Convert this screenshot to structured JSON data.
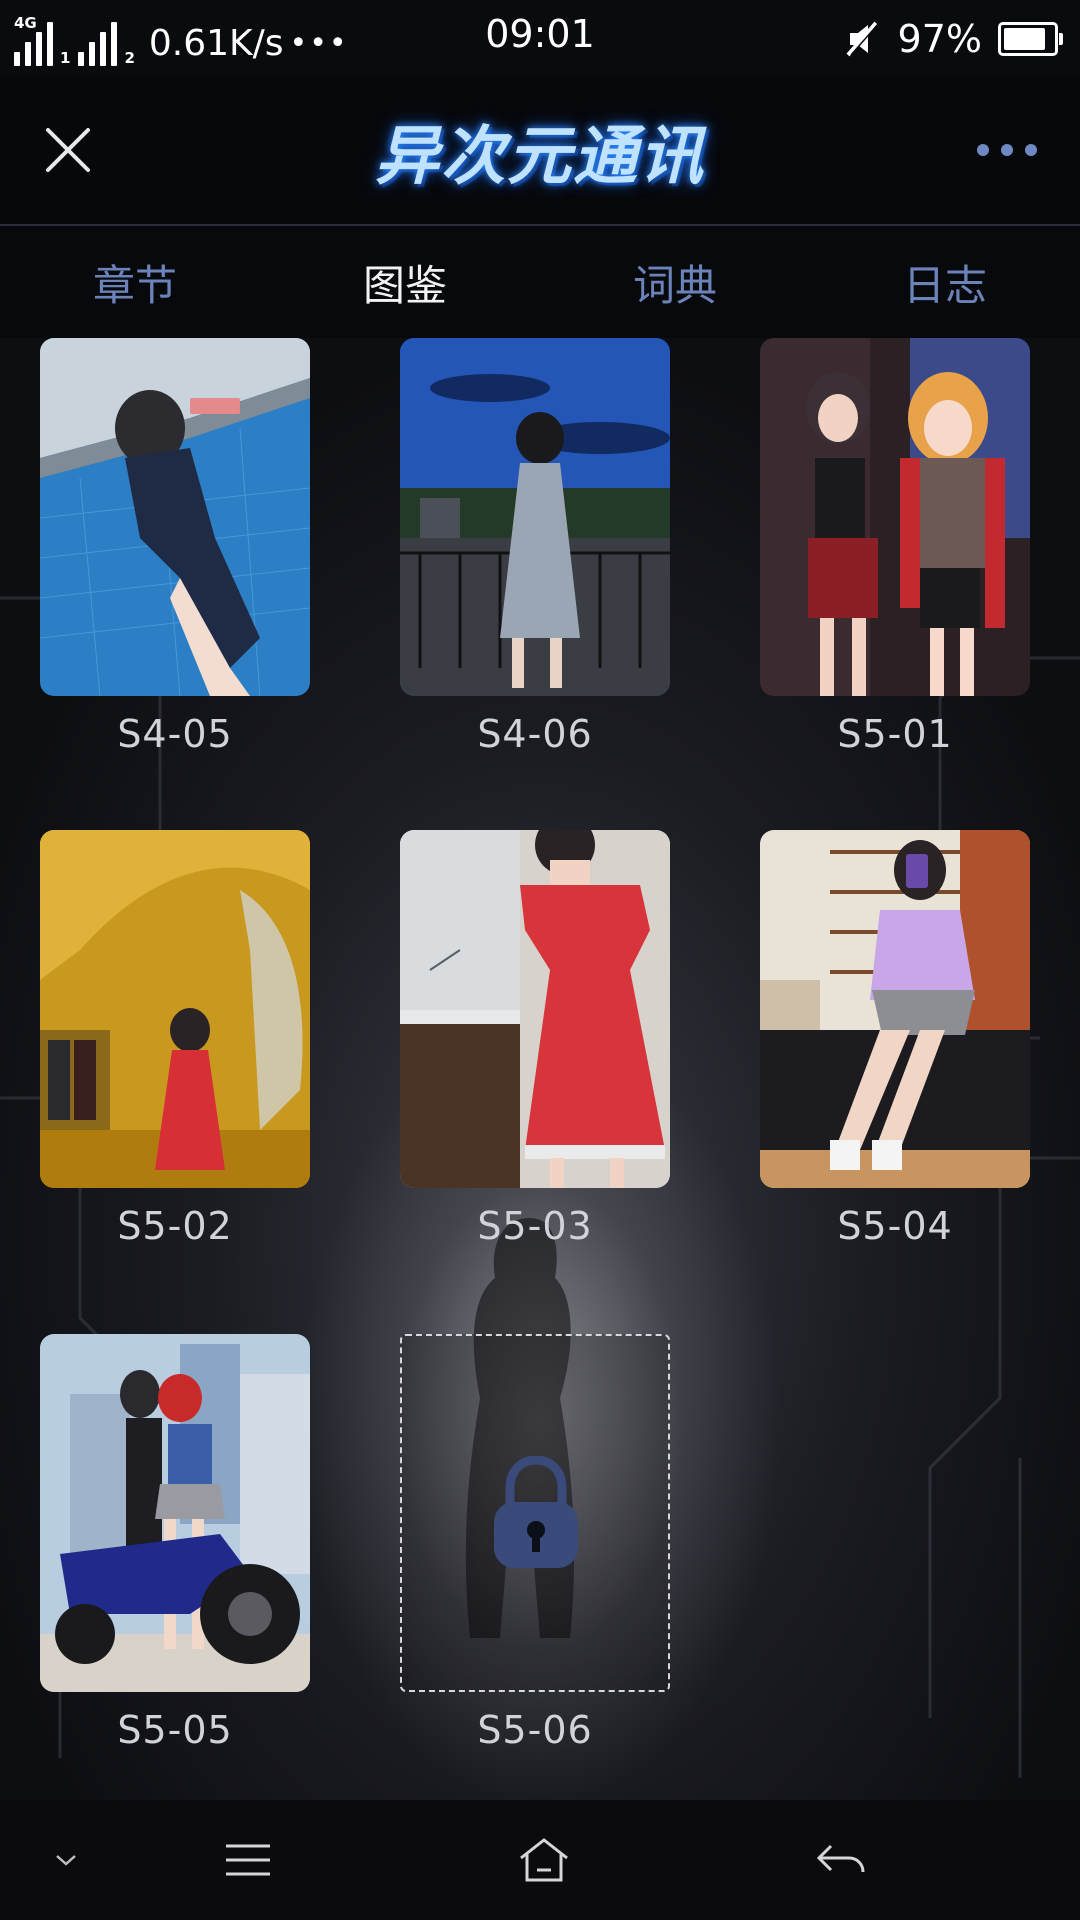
{
  "status_bar": {
    "network_tag": "4G",
    "sim1": "1",
    "sim2": "2",
    "speed": "0.61K/s",
    "more": "•••",
    "time": "09:01",
    "battery_percent": "97%",
    "battery_level": 0.97,
    "icons": [
      "signal-icon",
      "mute-icon",
      "battery-icon"
    ]
  },
  "header": {
    "logo_text": "异次元通讯",
    "close_icon": "close-icon",
    "more_icon": "more-icon",
    "accent_color": "#6f8ac2"
  },
  "tabs": [
    {
      "label": "章节",
      "active": false
    },
    {
      "label": "图鉴",
      "active": true
    },
    {
      "label": "词典",
      "active": false
    },
    {
      "label": "日志",
      "active": false
    }
  ],
  "gallery": {
    "items": [
      {
        "label": "S4-05",
        "locked": false,
        "scene": "pool"
      },
      {
        "label": "S4-06",
        "locked": false,
        "scene": "balcony-night"
      },
      {
        "label": "S5-01",
        "locked": false,
        "scene": "two-girls-graffiti"
      },
      {
        "label": "S5-02",
        "locked": false,
        "scene": "cinema-hall"
      },
      {
        "label": "S5-03",
        "locked": false,
        "scene": "red-dress-showroom"
      },
      {
        "label": "S5-04",
        "locked": false,
        "scene": "shoe-store"
      },
      {
        "label": "S5-05",
        "locked": false,
        "scene": "motorcycle-city"
      },
      {
        "label": "S5-06",
        "locked": true,
        "scene": "lock-icon"
      }
    ]
  },
  "nav_bar": {
    "icons": [
      "chevron-down-icon",
      "menu-icon",
      "home-icon",
      "back-icon"
    ]
  }
}
